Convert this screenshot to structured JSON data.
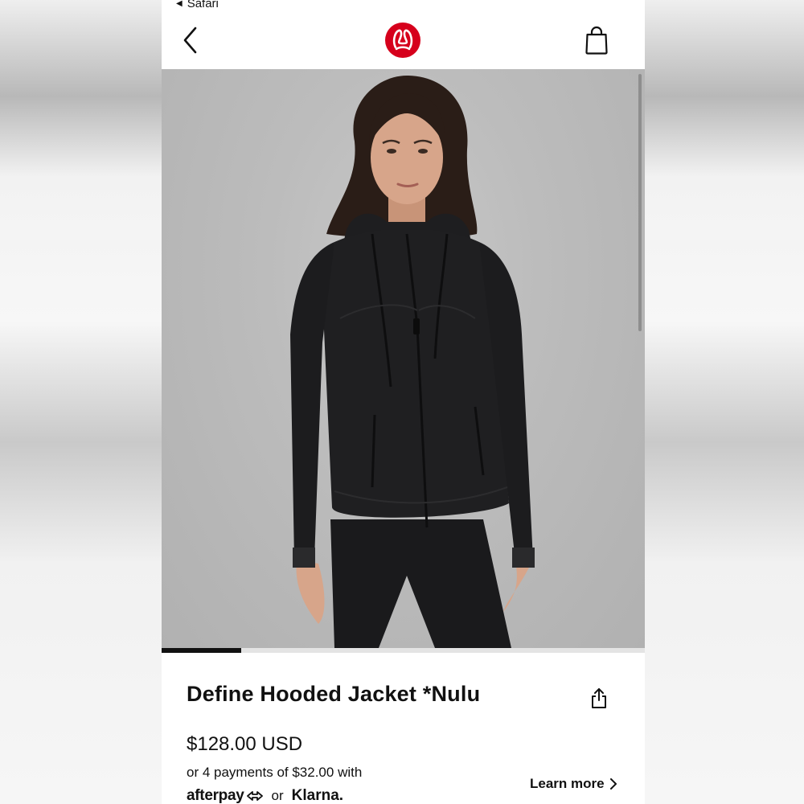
{
  "status_bar": {
    "back_app": "Safari"
  },
  "product": {
    "title": "Define Hooded Jacket *Nulu",
    "price": "$128.00 USD",
    "installments": "or 4 payments of $32.00 with",
    "pay_or": "or",
    "afterpay": "afterpay",
    "klarna": "Klarna.",
    "learn_more": "Learn more"
  },
  "gallery": {
    "current_image_fraction": 0.165
  },
  "colors": {
    "brand_red": "#d6001c",
    "text": "#111111",
    "photo_backdrop": "#bcbcbc",
    "jacket": "#1c1c1e"
  },
  "icons": {
    "back": "chevron-left-icon",
    "logo": "lululemon-logo",
    "bag": "shopping-bag-icon",
    "share": "share-icon",
    "learn_more": "chevron-right-icon"
  }
}
